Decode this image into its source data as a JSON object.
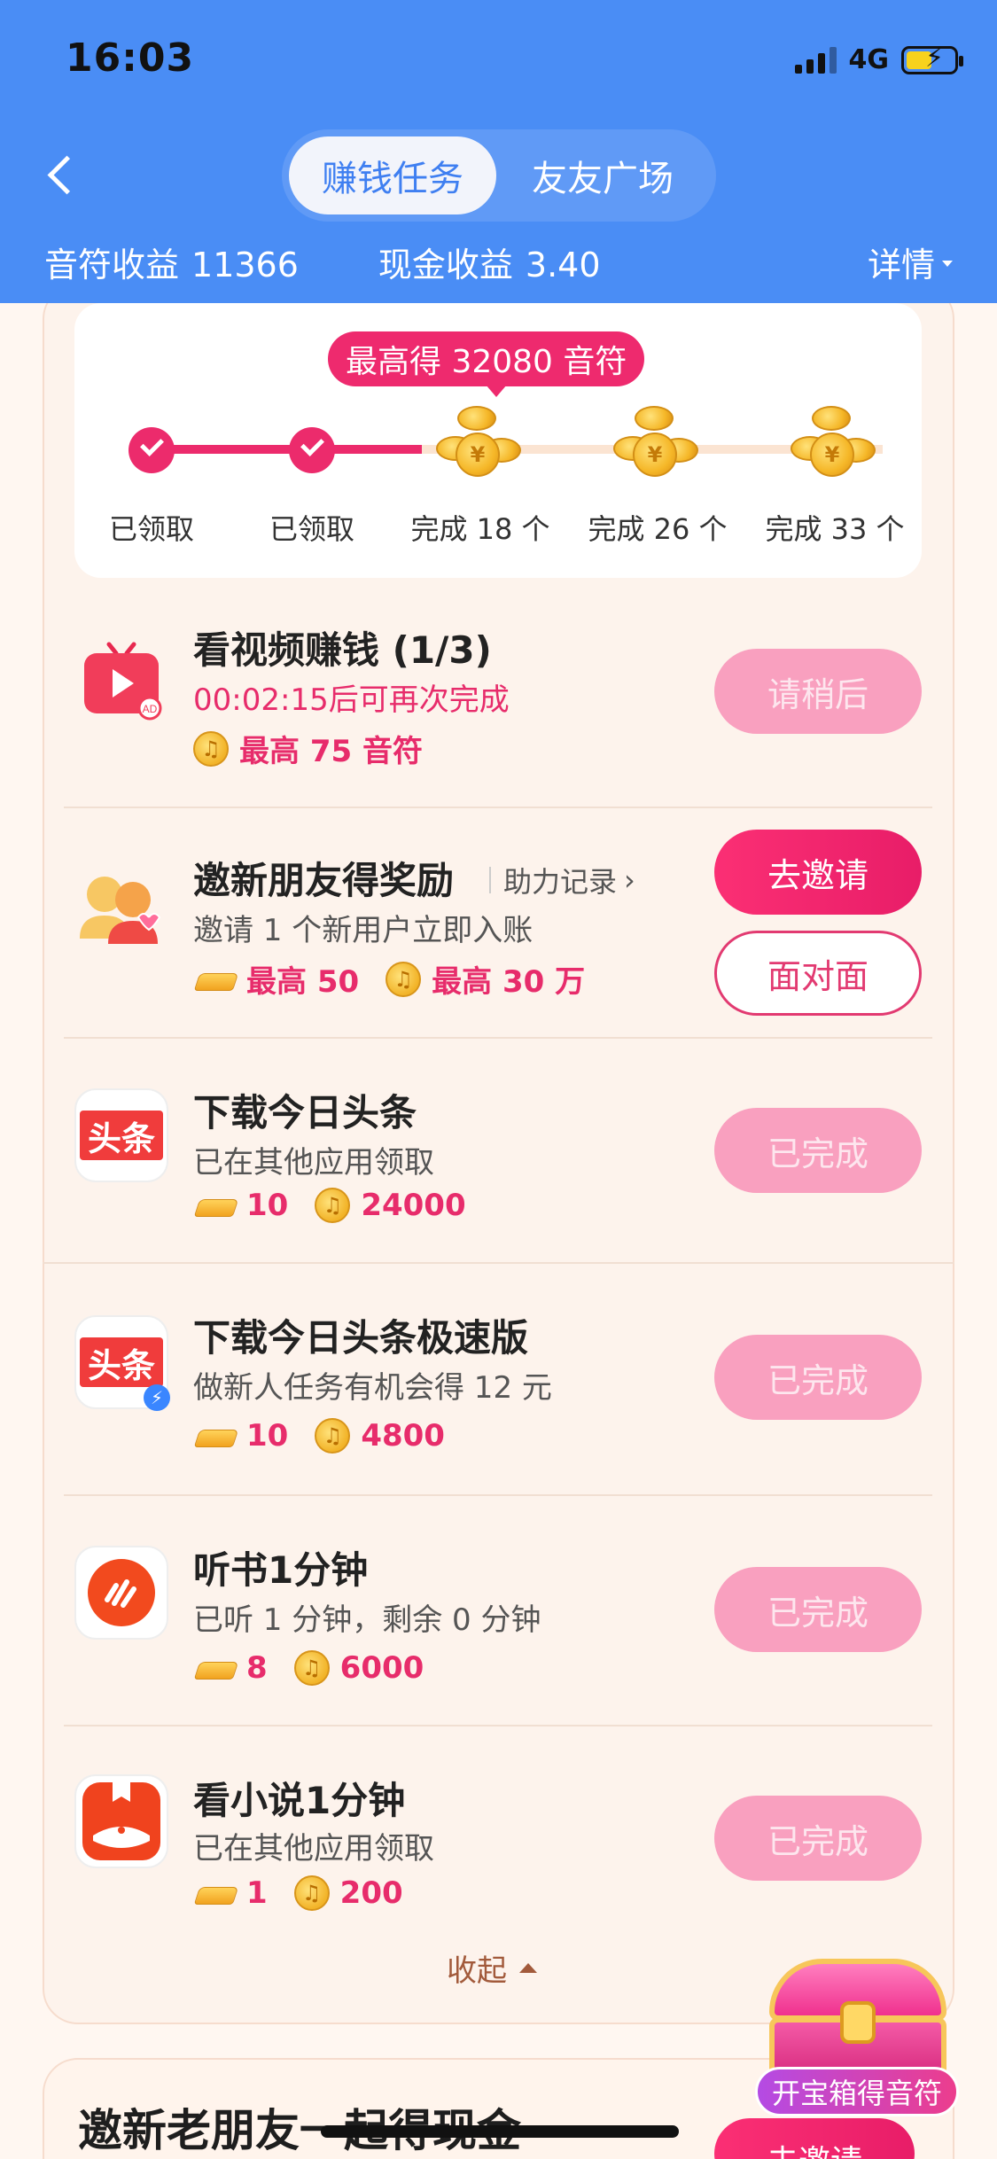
{
  "status_bar": {
    "time": "16:03",
    "network": "4G"
  },
  "nav": {
    "tabs": [
      {
        "label": "赚钱任务",
        "active": true
      },
      {
        "label": "友友广场",
        "active": false
      }
    ]
  },
  "earnings": {
    "note_label": "音符收益",
    "note_value": "11366",
    "cash_label": "现金收益",
    "cash_value": "3.40",
    "detail_label": "详情"
  },
  "progress": {
    "tooltip": "最高得 32080 音符",
    "steps": [
      {
        "label": "已领取",
        "state": "done"
      },
      {
        "label": "已领取",
        "state": "done"
      },
      {
        "label": "完成 18 个",
        "state": "pending"
      },
      {
        "label": "完成 26 个",
        "state": "pending"
      },
      {
        "label": "完成 33 个",
        "state": "pending"
      }
    ],
    "completed_fraction": 0.42
  },
  "tasks": [
    {
      "title": "看视频赚钱 (1/3)",
      "subtitle": "00:02:15后可再次完成",
      "note_reward": "最高 75 音符",
      "button": "请稍后",
      "icon": "video-ad-icon"
    },
    {
      "title": "邀新朋友得奖励",
      "link": "助力记录",
      "subtitle": "邀请 1 个新用户立即入账",
      "gold_reward": "最高 50",
      "note_reward": "最高 30 万",
      "button": "去邀请",
      "button2": "面对面",
      "icon": "friends-icon"
    },
    {
      "title": "下载今日头条",
      "subtitle": "已在其他应用领取",
      "gold_reward": "10",
      "note_reward": "24000",
      "button": "已完成",
      "icon": "toutiao-icon",
      "icon_text": "头条"
    },
    {
      "title": "下载今日头条极速版",
      "subtitle": "做新人任务有机会得 12 元",
      "gold_reward": "10",
      "note_reward": "4800",
      "button": "已完成",
      "icon": "toutiao-lite-icon",
      "icon_text": "头条"
    },
    {
      "title": "听书1分钟",
      "subtitle": "已听 1 分钟，剩余 0 分钟",
      "gold_reward": "8",
      "note_reward": "6000",
      "button": "已完成",
      "icon": "audiobook-icon"
    },
    {
      "title": "看小说1分钟",
      "subtitle": "已在其他应用领取",
      "gold_reward": "1",
      "note_reward": "200",
      "button": "已完成",
      "icon": "novel-icon"
    }
  ],
  "collapse_label": "收起",
  "bottom_card": {
    "title": "邀新老朋友一起得现金",
    "button": "去邀请"
  },
  "treasure": {
    "label": "开宝箱得音符"
  },
  "colors": {
    "header_blue": "#4a8df5",
    "accent_pink": "#ec2b6c",
    "disabled_pink": "#f9a0bf"
  }
}
